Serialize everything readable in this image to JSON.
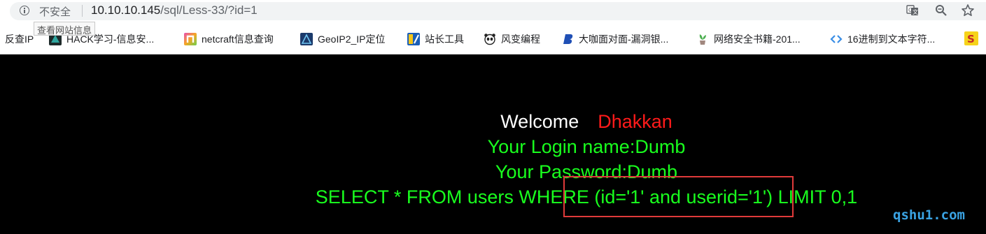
{
  "browser": {
    "security_label": "不安全",
    "url_host": "10.10.10.145",
    "url_path": "/sql/Less-33/?id=1",
    "tooltip": "查看网站信息"
  },
  "bookmarks": [
    {
      "label": "反查IP",
      "icon": "none"
    },
    {
      "label": "HACK学习-信息安...",
      "icon": "hack-logo-icon"
    },
    {
      "label": "netcraft信息查询",
      "icon": "netcraft-icon"
    },
    {
      "label": "GeoIP2_IP定位",
      "icon": "geoip-icon"
    },
    {
      "label": "站长工具",
      "icon": "chinaz-icon"
    },
    {
      "label": "风变编程",
      "icon": "panda-icon"
    },
    {
      "label": "大咖面对面-漏洞银...",
      "icon": "bugbank-icon"
    },
    {
      "label": "网络安全书籍-201...",
      "icon": "plant-icon"
    },
    {
      "label": "16进制到文本字符...",
      "icon": "code-icon"
    }
  ],
  "page": {
    "welcome": "Welcome",
    "user_name": "Dhakkan",
    "login_line": "Your Login name:Dumb",
    "password_line": "Your Password:Dumb",
    "query_line": "SELECT * FROM users WHERE (id='1' and userid='1') LIMIT 0,1",
    "watermark": "qshu1.com"
  },
  "colors": {
    "page_background": "#000000",
    "welcome_text": "#ffffff",
    "name_text": "#ff1a1a",
    "result_text": "#19ff1e",
    "highlight_box": "#e03a3a",
    "watermark": "#3aa3e3"
  }
}
